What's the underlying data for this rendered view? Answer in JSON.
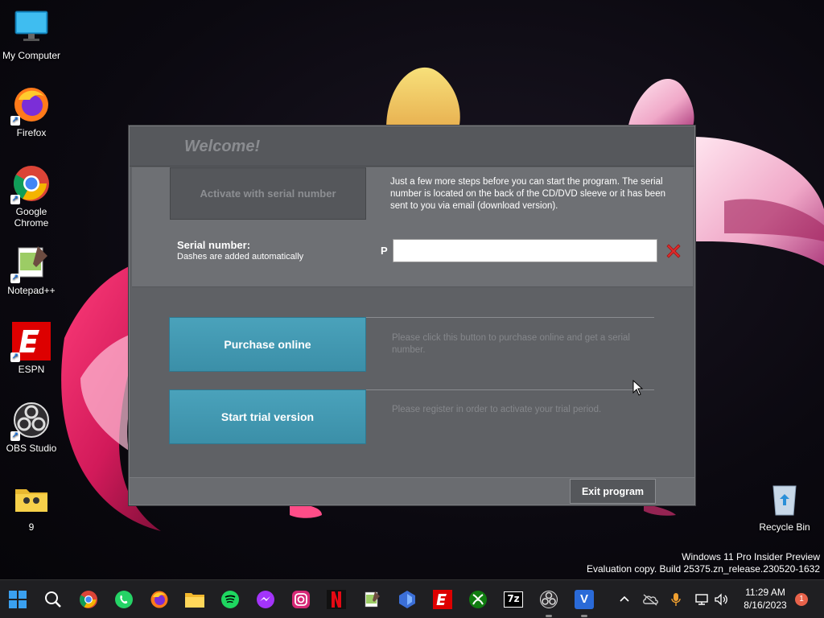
{
  "desktop": {
    "icons": [
      {
        "label": "My Computer",
        "icon": "monitor-icon"
      },
      {
        "label": "Firefox",
        "icon": "firefox-icon"
      },
      {
        "label": "Google Chrome",
        "icon": "chrome-icon"
      },
      {
        "label": "Notepad++",
        "icon": "notepadpp-icon"
      },
      {
        "label": "ESPN",
        "icon": "espn-icon"
      },
      {
        "label": "OBS Studio",
        "icon": "obs-icon"
      },
      {
        "label": "9",
        "icon": "folder-icon"
      },
      {
        "label": "Recycle Bin",
        "icon": "recycle-bin-icon"
      }
    ]
  },
  "dialog": {
    "title": "Welcome!",
    "activate_button": "Activate with serial number",
    "activate_description": "Just a few more steps before you can start the program. The serial number is located on the back of the CD/DVD sleeve or it has been sent to you via email (download version).",
    "serial_label": "Serial number:",
    "serial_sublabel": "Dashes are added automatically",
    "serial_prefix": "P",
    "serial_value": "",
    "purchase_button": "Purchase online",
    "purchase_description": "Please click this button to purchase online and get a serial number.",
    "trial_button": "Start trial version",
    "trial_description": "Please register in order to activate your trial period.",
    "exit_button": "Exit program"
  },
  "watermark": {
    "line1": "Windows 11 Pro Insider Preview",
    "line2": "Evaluation copy. Build 25375.zn_release.230520-1632"
  },
  "taskbar": {
    "apps": [
      "start-icon",
      "search-icon",
      "chrome-icon",
      "whatsapp-icon",
      "firefox-icon",
      "file-explorer-icon",
      "spotify-icon",
      "messenger-icon",
      "instagram-icon",
      "netflix-icon",
      "notepadpp-icon",
      "app-icon",
      "espn-icon",
      "xbox-icon",
      "7zip-icon",
      "obs-icon",
      "v-app-icon"
    ],
    "time": "11:29 AM",
    "date": "8/16/2023",
    "notification_count": "1",
    "seven_zip_label": "7z",
    "v_label": "V"
  },
  "colors": {
    "accent_button": "#4aa2bb",
    "dialog_bg": "#5f6165",
    "clear_x": "#e02b2b"
  }
}
